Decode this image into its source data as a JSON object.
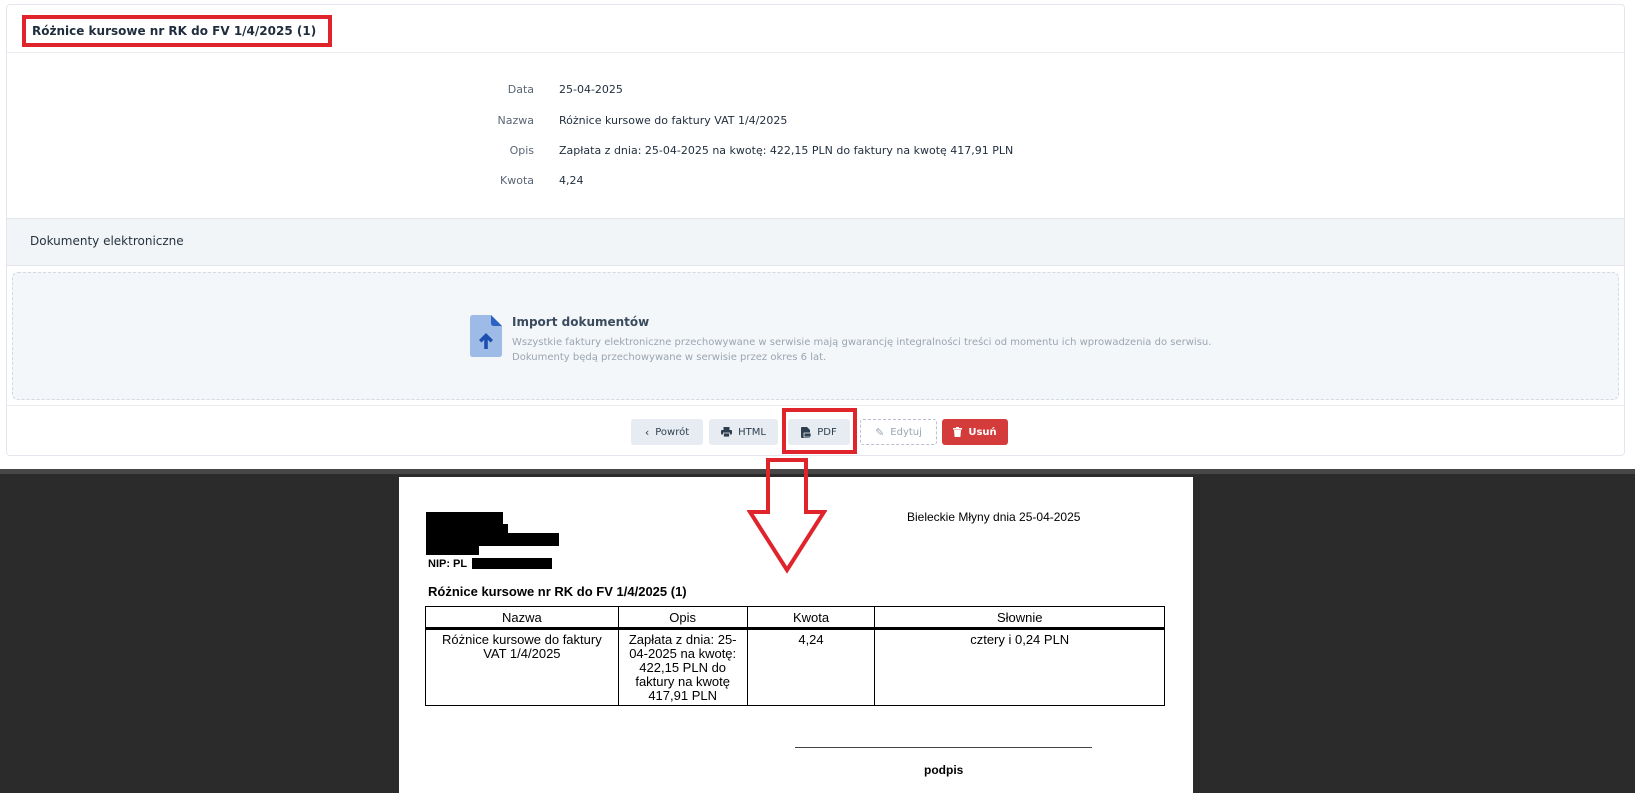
{
  "record": {
    "title": "Różnice kursowe nr RK do FV 1/4/2025 (1)",
    "fields": [
      {
        "label": "Data",
        "value": "25-04-2025"
      },
      {
        "label": "Nazwa",
        "value": "Różnice kursowe do faktury VAT 1/4/2025"
      },
      {
        "label": "Opis",
        "value": "Zapłata z dnia: 25-04-2025 na kwotę: 422,15 PLN do faktury na kwotę 417,91 PLN"
      },
      {
        "label": "Kwota",
        "value": "4,24"
      }
    ]
  },
  "edocs": {
    "section_title": "Dokumenty elektroniczne",
    "import_title": "Import dokumentów",
    "import_line1": "Wszystkie faktury elektroniczne przechowywane w serwisie mają gwarancję integralności treści od momentu ich wprowadzenia do serwisu.",
    "import_line2": "Dokumenty będą przechowywane w serwisie przez okres 6 lat.",
    "icon": "file-upload-icon"
  },
  "actions": {
    "back": "Powrót",
    "html": "HTML",
    "pdf": "PDF",
    "edit": "Edytuj",
    "delete": "Usuń"
  },
  "colors": {
    "highlight": "#e0242c",
    "danger": "#d43c3c",
    "accent": "#5b8fd9"
  },
  "pdf_preview": {
    "nip_label": "NIP: PL",
    "place_date": "Bieleckie Młyny dnia 25-04-2025",
    "title": "Różnice kursowe nr RK do FV 1/4/2025 (1)",
    "columns": [
      "Nazwa",
      "Opis",
      "Kwota",
      "Słownie"
    ],
    "row": {
      "nazwa": "Różnice kursowe do faktury VAT 1/4/2025",
      "opis": "Zapłata z dnia: 25-04-2025 na kwotę: 422,15 PLN do faktury na kwotę 417,91 PLN",
      "kwota": "4,24",
      "slownie": "cztery i 0,24 PLN"
    },
    "signature_label": "podpis"
  }
}
